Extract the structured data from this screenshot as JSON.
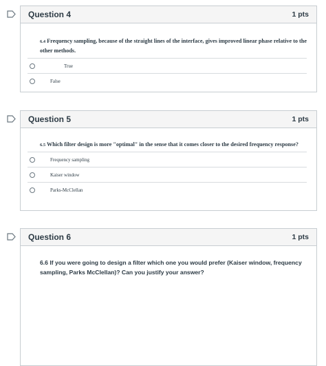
{
  "questions": [
    {
      "title": "Question 4",
      "points": "1 pts",
      "number": "6.4",
      "text": "Frequency sampling, because of the straight lines of the interface, gives improved linear phase relative to the other methods.",
      "answers": [
        "True",
        "False"
      ]
    },
    {
      "title": "Question 5",
      "points": "1 pts",
      "number": "6.5",
      "text": "Which filter design is more \"optimal\" in the sense that it comes closer to the desired frequency response?",
      "answers": [
        "Frequency sampling",
        "Kaiser window",
        "Parks-McClellan"
      ]
    },
    {
      "title": "Question 6",
      "points": "1 pts",
      "text": "6.6 If you were going to design a filter which one you would prefer (Kaiser window, frequency sampling, Parks McClellan)? Can you justify your answer?"
    }
  ]
}
